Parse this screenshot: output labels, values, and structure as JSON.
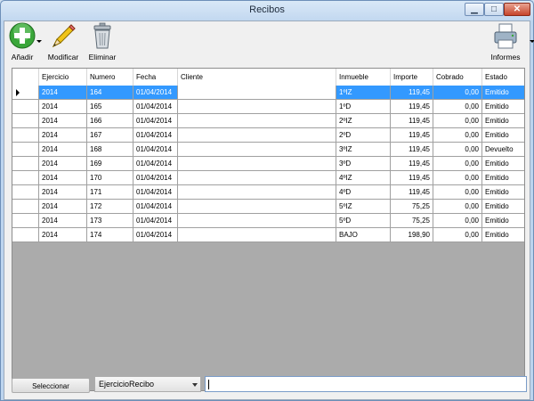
{
  "window": {
    "title": "Recibos"
  },
  "toolbar": {
    "add_label": "Añadir",
    "edit_label": "Modificar",
    "delete_label": "Eliminar",
    "reports_label": "Informes"
  },
  "grid": {
    "columns": [
      "Ejercicio",
      "Numero",
      "Fecha",
      "Cliente",
      "Inmueble",
      "Importe",
      "Cobrado",
      "Estado"
    ],
    "rows": [
      [
        "2014",
        "164",
        "01/04/2014",
        "",
        "1ºIZ",
        "119,45",
        "0,00",
        "Emitido"
      ],
      [
        "2014",
        "165",
        "01/04/2014",
        "",
        "1ºD",
        "119,45",
        "0,00",
        "Emitido"
      ],
      [
        "2014",
        "166",
        "01/04/2014",
        "",
        "2ºIZ",
        "119,45",
        "0,00",
        "Emitido"
      ],
      [
        "2014",
        "167",
        "01/04/2014",
        "",
        "2ºD",
        "119,45",
        "0,00",
        "Emitido"
      ],
      [
        "2014",
        "168",
        "01/04/2014",
        "",
        "3ºIZ",
        "119,45",
        "0,00",
        "Devuelto"
      ],
      [
        "2014",
        "169",
        "01/04/2014",
        "",
        "3ºD",
        "119,45",
        "0,00",
        "Emitido"
      ],
      [
        "2014",
        "170",
        "01/04/2014",
        "",
        "4ºIZ",
        "119,45",
        "0,00",
        "Emitido"
      ],
      [
        "2014",
        "171",
        "01/04/2014",
        "",
        "4ºD",
        "119,45",
        "0,00",
        "Emitido"
      ],
      [
        "2014",
        "172",
        "01/04/2014",
        "",
        "5ºIZ",
        "75,25",
        "0,00",
        "Emitido"
      ],
      [
        "2014",
        "173",
        "01/04/2014",
        "",
        "5ºD",
        "75,25",
        "0,00",
        "Emitido"
      ],
      [
        "2014",
        "174",
        "01/04/2014",
        "",
        "BAJO",
        "198,90",
        "0,00",
        "Emitido"
      ]
    ],
    "selected_row": 0
  },
  "footer": {
    "select_button_label": "Seleccionar",
    "field_select_value": "EjercicioRecibo",
    "search_value": ""
  },
  "colors": {
    "selection": "#3399ff",
    "grid_background": "#ababab"
  }
}
